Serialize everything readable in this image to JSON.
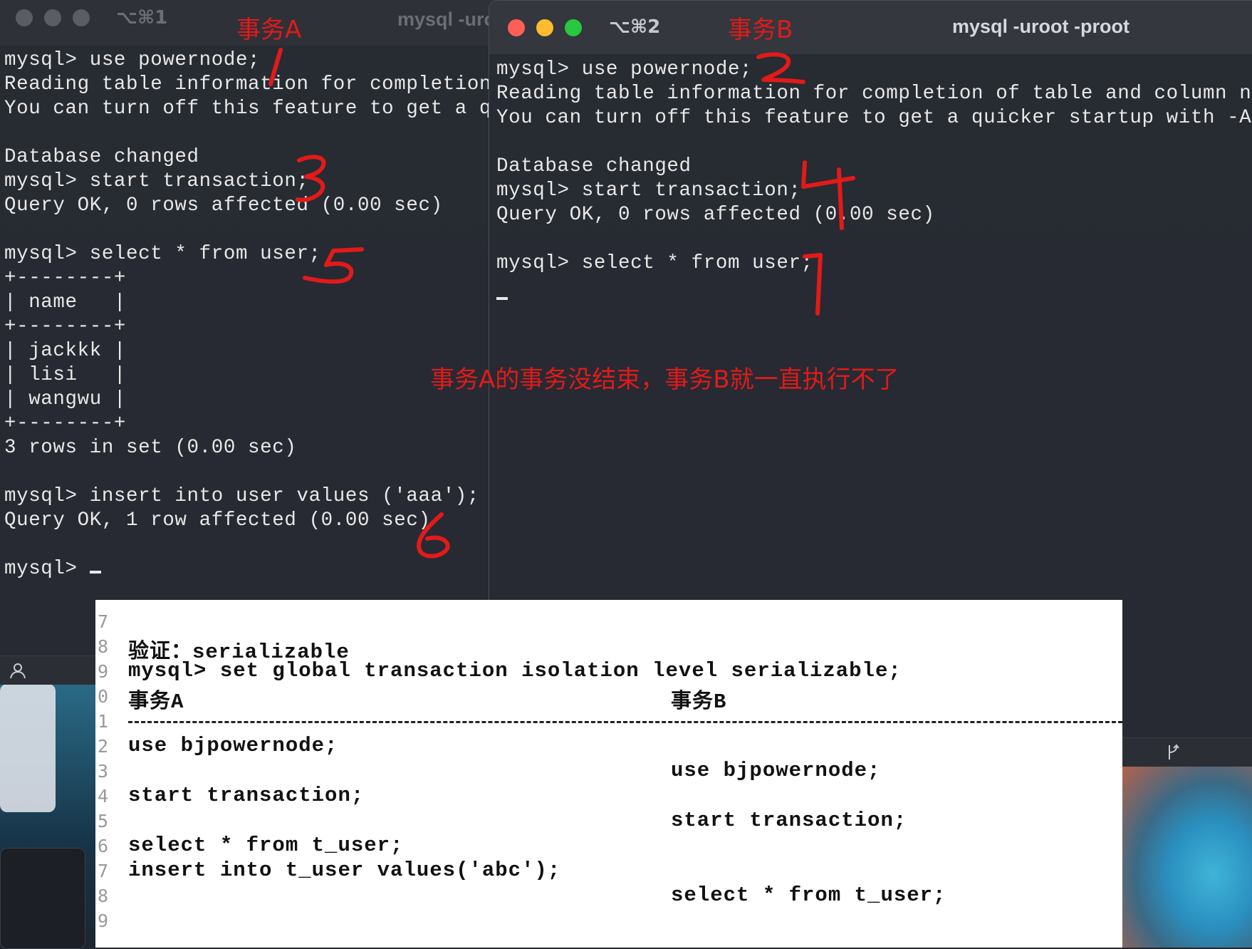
{
  "window_a": {
    "shortcut": "⌥⌘1",
    "title": "mysql -uroot -proot",
    "terminal_lines": [
      "mysql> use powernode;",
      "Reading table information for completion of table and column names",
      "You can turn off this feature to get a quicker startup with -A",
      "",
      "Database changed",
      "mysql> start transaction;",
      "Query OK, 0 rows affected (0.00 sec)",
      "",
      "mysql> select * from user;",
      "+--------+",
      "| name   |",
      "+--------+",
      "| jackkk |",
      "| lisi   |",
      "| wangwu |",
      "+--------+",
      "3 rows in set (0.00 sec)",
      "",
      "mysql> insert into user values ('aaa');",
      "Query OK, 1 row affected (0.00 sec)",
      "",
      "mysql> "
    ]
  },
  "window_b": {
    "shortcut": "⌥⌘2",
    "title": "mysql -uroot -proot",
    "terminal_lines": [
      "mysql> use powernode;",
      "Reading table information for completion of table and column names",
      "You can turn off this feature to get a quicker startup with -A",
      "",
      "Database changed",
      "mysql> start transaction;",
      "Query OK, 0 rows affected (0.00 sec)",
      "",
      "mysql> select * from user;"
    ]
  },
  "annotations": {
    "label_a": "事务A",
    "label_b": "事务B",
    "note": "事务A的事务没结束，事务B就一直执行不了",
    "step_numbers": [
      "1",
      "2",
      "3",
      "4",
      "5",
      "6",
      "7"
    ]
  },
  "doc": {
    "line_numbers": [
      "7",
      "8",
      "9",
      "0",
      "1",
      "2",
      "3",
      "4",
      "5",
      "6",
      "7",
      "8",
      "9"
    ],
    "verify": "验证：serializable",
    "set_cmd": "mysql> set global transaction isolation level serializable;",
    "header_a": "事务A",
    "header_b": "事务B",
    "a_use": "use bjpowernode;",
    "b_use": "use bjpowernode;",
    "a_start": "start transaction;",
    "b_start": "start transaction;",
    "a_select": "select * from t_user;",
    "a_insert": "insert into t_user values('abc');",
    "b_select": "select * from t_user;"
  },
  "colors": {
    "annotation_red": "#e21a1a",
    "traffic_red": "#ff5f57",
    "traffic_yellow": "#febc2e",
    "traffic_green": "#28c840"
  }
}
